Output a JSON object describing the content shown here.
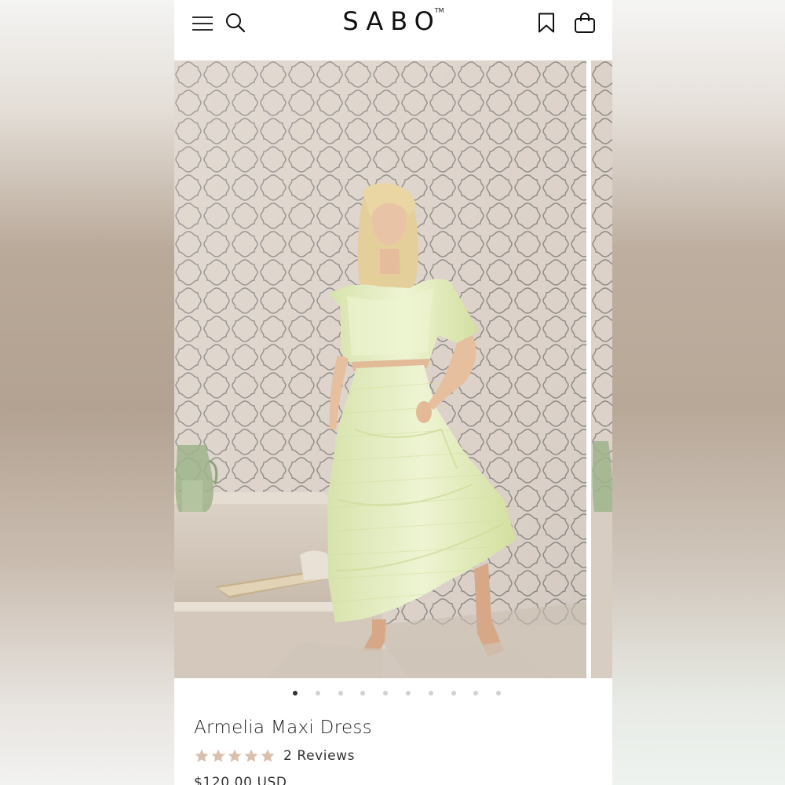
{
  "brand": {
    "logo_text": "SABO",
    "trademark": "TM"
  },
  "header": {
    "icons": [
      "menu-icon",
      "search-icon",
      "bookmark-icon",
      "shopping-bag-icon"
    ]
  },
  "gallery": {
    "slide_count": 10,
    "active_index": 0
  },
  "product": {
    "title": "Armelia Maxi Dress",
    "rating": 5,
    "rating_max": 5,
    "reviews_label": "2 Reviews",
    "price": "$120.00 USD"
  },
  "colors": {
    "text": "#222222",
    "star": "#d8bfae",
    "dot_active": "#333333",
    "dot_inactive": "#d2d2d2",
    "dress": "#e6efc6"
  }
}
